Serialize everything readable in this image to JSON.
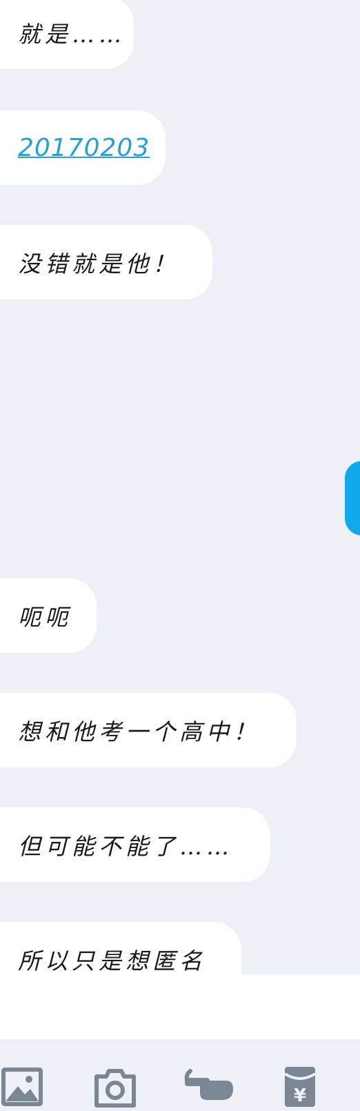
{
  "messages": [
    {
      "text": "就是……",
      "type": "text"
    },
    {
      "text": "20170203",
      "type": "link"
    },
    {
      "text": "没错就是他！",
      "type": "text"
    },
    {
      "text": "呃呃",
      "type": "text"
    },
    {
      "text": "想和他考一个高中！",
      "type": "text"
    },
    {
      "text": "但可能不能了……",
      "type": "text"
    },
    {
      "text": "所以只是想匿名",
      "type": "text"
    }
  ],
  "toolbar": {
    "items": [
      {
        "icon": "image-icon",
        "label": "picture"
      },
      {
        "icon": "camera-icon",
        "label": "camera"
      },
      {
        "icon": "poke-icon",
        "label": "poke"
      },
      {
        "icon": "red-packet-icon",
        "label": "red packet",
        "symbol": "¥"
      }
    ]
  },
  "colors": {
    "background": "#edf1f7",
    "bubble": "#ffffff",
    "link": "#2a9fd6",
    "accent": "#12a8ec",
    "icon": "#7a8694"
  }
}
